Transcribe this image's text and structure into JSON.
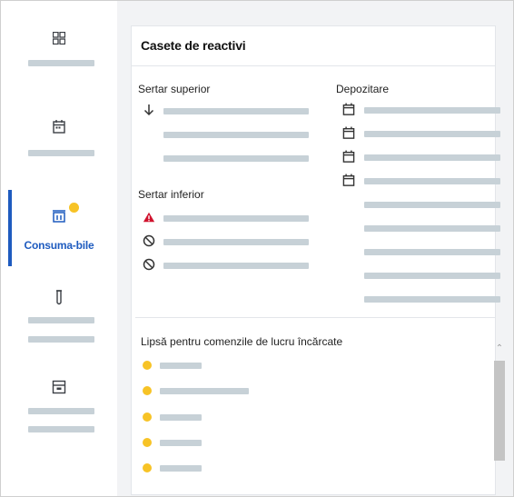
{
  "sidebar": {
    "items": [
      {
        "icon": "grid-icon"
      },
      {
        "icon": "calendar-icon"
      },
      {
        "icon": "consumables-icon",
        "label": "Consuma-bile",
        "active": true,
        "badge_color": "#f7c326"
      },
      {
        "icon": "test-tube-icon"
      },
      {
        "icon": "storage-box-icon"
      }
    ],
    "accent_color": "#1e5bbf"
  },
  "card": {
    "title": "Casete de reactivi",
    "upper_drawer": {
      "title": "Sertar superior",
      "rows": [
        {
          "icon": "arrow-down-icon"
        },
        {
          "icon": ""
        },
        {
          "icon": ""
        }
      ]
    },
    "lower_drawer": {
      "title": "Sertar inferior",
      "rows": [
        {
          "icon": "warning-icon",
          "color": "#d0122d"
        },
        {
          "icon": "blocked-icon"
        },
        {
          "icon": "blocked-icon"
        }
      ]
    },
    "storage": {
      "title": "Depozitare",
      "rows": [
        {
          "icon": "calendar-icon"
        },
        {
          "icon": "calendar-icon"
        },
        {
          "icon": "calendar-icon"
        },
        {
          "icon": "calendar-icon"
        },
        {
          "icon": ""
        },
        {
          "icon": ""
        },
        {
          "icon": ""
        },
        {
          "icon": ""
        },
        {
          "icon": ""
        }
      ]
    },
    "missing": {
      "title": "Lipsă pentru comenzile de lucru încărcate",
      "dot_color": "#f7c326",
      "row_count": 5
    }
  }
}
